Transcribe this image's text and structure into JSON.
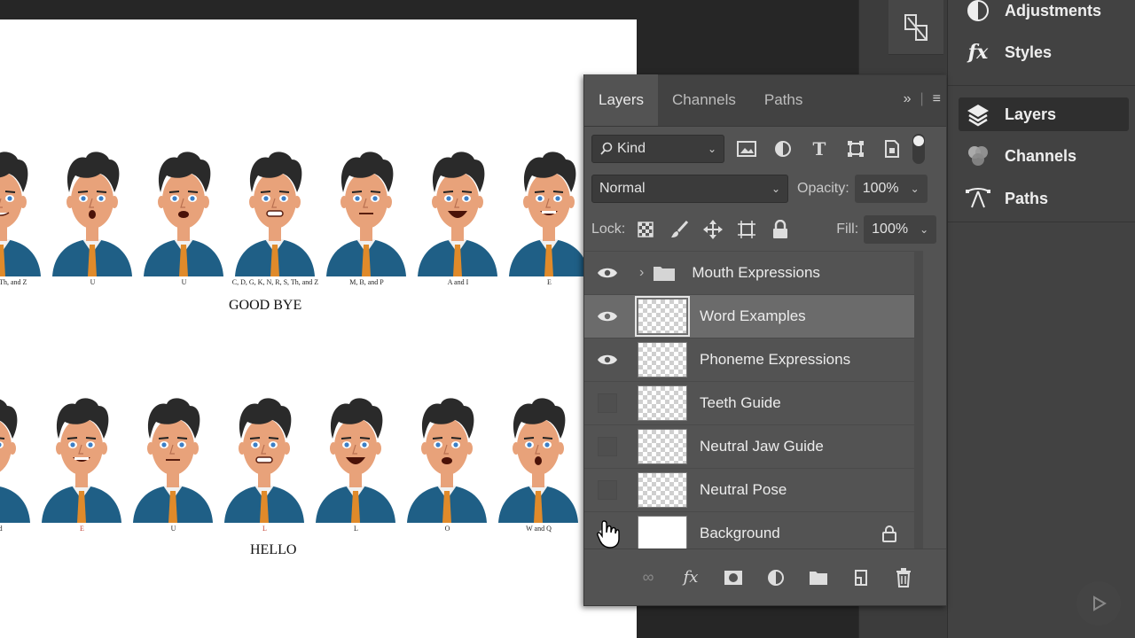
{
  "canvas": {
    "row1_captions": [
      "E, R, S, Th, and Z",
      "U",
      "U",
      "C, D, G, K, N, R, S, Th, and Z",
      "M, B, and P",
      "A and I",
      "E"
    ],
    "row1_word": "GOOD BYE",
    "row2_captions": [
      "Relaxed",
      "E",
      "U",
      "L",
      "L",
      "O",
      "W and Q"
    ],
    "row2_word": "HELLO"
  },
  "layers_panel": {
    "tabs": [
      {
        "label": "Layers",
        "active": true
      },
      {
        "label": "Channels",
        "active": false
      },
      {
        "label": "Paths",
        "active": false
      }
    ],
    "filter": {
      "icon": "search-icon",
      "value": "Kind"
    },
    "blend_mode": "Normal",
    "opacity_label": "Opacity:",
    "opacity_value": "100%",
    "lock_label": "Lock:",
    "fill_label": "Fill:",
    "fill_value": "100%",
    "layers": [
      {
        "name": "Mouth Expressions",
        "type": "group",
        "visible": true,
        "selected": false
      },
      {
        "name": "Word Examples",
        "type": "pixel",
        "visible": true,
        "selected": true
      },
      {
        "name": "Phoneme Expressions",
        "type": "pixel",
        "visible": true,
        "selected": false
      },
      {
        "name": "Teeth Guide",
        "type": "pixel",
        "visible": false,
        "selected": false
      },
      {
        "name": "Neutral Jaw Guide",
        "type": "pixel",
        "visible": false,
        "selected": false
      },
      {
        "name": "Neutral Pose",
        "type": "pixel",
        "visible": false,
        "selected": false
      },
      {
        "name": "Background",
        "type": "background",
        "visible": true,
        "selected": false,
        "locked": true
      }
    ]
  },
  "dock": {
    "items": [
      {
        "label": "Adjustments",
        "icon": "adjustments-icon",
        "active": false
      },
      {
        "label": "Styles",
        "icon": "fx-icon",
        "active": false
      },
      {
        "label": "Layers",
        "icon": "layers-icon",
        "active": true
      },
      {
        "label": "Channels",
        "icon": "channels-icon",
        "active": false
      },
      {
        "label": "Paths",
        "icon": "paths-icon",
        "active": false
      }
    ]
  },
  "colors": {
    "panel_bg": "#535353",
    "selected_layer": "#6b6b6b",
    "dock_bg": "#424242",
    "shirt": "#1f5f86",
    "tie": "#e08a2a",
    "skin": "#e8a27a",
    "hair": "#2a2a2a"
  }
}
